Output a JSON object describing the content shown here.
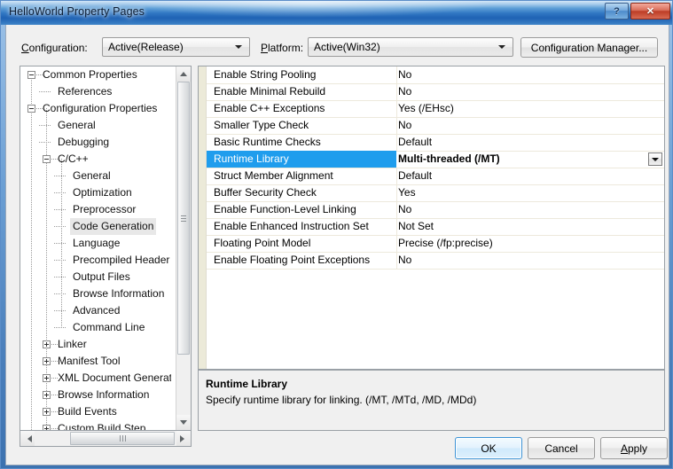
{
  "window": {
    "title": "HelloWorld Property Pages",
    "help_label": "?",
    "close_label": "✕"
  },
  "configbar": {
    "configuration_label": "Configuration:",
    "configuration_value": "Active(Release)",
    "platform_label": "Platform:",
    "platform_value": "Active(Win32)",
    "configuration_manager_label": "Configuration Manager..."
  },
  "tree": {
    "items": [
      {
        "label": "Common Properties",
        "depth": 0,
        "glyph": "minus",
        "selected": false
      },
      {
        "label": "References",
        "depth": 1,
        "glyph": "none",
        "selected": false
      },
      {
        "label": "Configuration Properties",
        "depth": 0,
        "glyph": "minus",
        "selected": false
      },
      {
        "label": "General",
        "depth": 1,
        "glyph": "none",
        "selected": false
      },
      {
        "label": "Debugging",
        "depth": 1,
        "glyph": "none",
        "selected": false
      },
      {
        "label": "C/C++",
        "depth": 1,
        "glyph": "minus",
        "selected": false
      },
      {
        "label": "General",
        "depth": 2,
        "glyph": "none",
        "selected": false
      },
      {
        "label": "Optimization",
        "depth": 2,
        "glyph": "none",
        "selected": false
      },
      {
        "label": "Preprocessor",
        "depth": 2,
        "glyph": "none",
        "selected": false
      },
      {
        "label": "Code Generation",
        "depth": 2,
        "glyph": "none",
        "selected": true
      },
      {
        "label": "Language",
        "depth": 2,
        "glyph": "none",
        "selected": false
      },
      {
        "label": "Precompiled Header",
        "depth": 2,
        "glyph": "none",
        "selected": false
      },
      {
        "label": "Output Files",
        "depth": 2,
        "glyph": "none",
        "selected": false
      },
      {
        "label": "Browse Information",
        "depth": 2,
        "glyph": "none",
        "selected": false
      },
      {
        "label": "Advanced",
        "depth": 2,
        "glyph": "none",
        "selected": false
      },
      {
        "label": "Command Line",
        "depth": 2,
        "glyph": "none",
        "selected": false
      },
      {
        "label": "Linker",
        "depth": 1,
        "glyph": "plus",
        "selected": false
      },
      {
        "label": "Manifest Tool",
        "depth": 1,
        "glyph": "plus",
        "selected": false
      },
      {
        "label": "XML Document Generator",
        "depth": 1,
        "glyph": "plus",
        "selected": false
      },
      {
        "label": "Browse Information",
        "depth": 1,
        "glyph": "plus",
        "selected": false
      },
      {
        "label": "Build Events",
        "depth": 1,
        "glyph": "plus",
        "selected": false
      },
      {
        "label": "Custom Build Step",
        "depth": 1,
        "glyph": "plus",
        "selected": false
      }
    ]
  },
  "grid": {
    "rows": [
      {
        "name": "Enable String Pooling",
        "value": "No",
        "selected": false
      },
      {
        "name": "Enable Minimal Rebuild",
        "value": "No",
        "selected": false
      },
      {
        "name": "Enable C++ Exceptions",
        "value": "Yes (/EHsc)",
        "selected": false
      },
      {
        "name": "Smaller Type Check",
        "value": "No",
        "selected": false
      },
      {
        "name": "Basic Runtime Checks",
        "value": "Default",
        "selected": false
      },
      {
        "name": "Runtime Library",
        "value": "Multi-threaded (/MT)",
        "selected": true
      },
      {
        "name": "Struct Member Alignment",
        "value": "Default",
        "selected": false
      },
      {
        "name": "Buffer Security Check",
        "value": "Yes",
        "selected": false
      },
      {
        "name": "Enable Function-Level Linking",
        "value": "No",
        "selected": false
      },
      {
        "name": "Enable Enhanced Instruction Set",
        "value": "Not Set",
        "selected": false
      },
      {
        "name": "Floating Point Model",
        "value": "Precise (/fp:precise)",
        "selected": false
      },
      {
        "name": "Enable Floating Point Exceptions",
        "value": "No",
        "selected": false
      }
    ]
  },
  "description": {
    "title": "Runtime Library",
    "body": "Specify runtime library for linking.",
    "extra": "(/MT, /MTd, /MD, /MDd)"
  },
  "footer": {
    "ok_label": "OK",
    "cancel_label": "Cancel",
    "apply_label": "Apply"
  },
  "colors": {
    "selection_blue": "#1f9ded",
    "tree_selection_gray": "#e8e8e8",
    "title_gradient_top": "#d3e6f7",
    "close_red": "#bd3d26"
  }
}
